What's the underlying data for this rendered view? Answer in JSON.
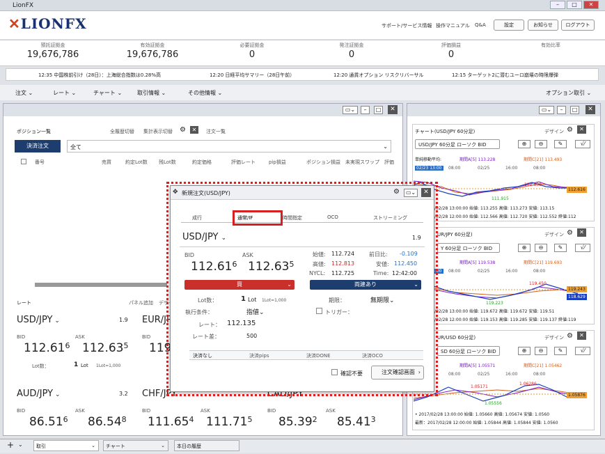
{
  "app": {
    "title": "LionFX",
    "logo": "LIONFX"
  },
  "header": {
    "links": [
      "サポート/サービス情報",
      "操作マニュアル",
      "Q&A"
    ],
    "buttons": [
      "設定",
      "お知らせ",
      "ログアウト"
    ]
  },
  "summary": [
    {
      "label": "預託証拠金",
      "value": "19,676,786"
    },
    {
      "label": "有効証拠金",
      "value": "19,676,786"
    },
    {
      "label": "必要証拠金",
      "value": "0"
    },
    {
      "label": "発注証拠金",
      "value": "0"
    },
    {
      "label": "評価損益",
      "value": "0"
    },
    {
      "label": "有効比率",
      "value": ""
    }
  ],
  "ticker": [
    "12:35 中国株前引け（28日）：上海総合指数は0.28%高",
    "12:20 日経平均サマリー（28日午前）",
    "12:20 通貨オプション リスクリバーサル",
    "12:15 ターゲット2に潜むユーロ崩壊の時限爆弾"
  ],
  "menu": [
    "注文",
    "レート",
    "チャート",
    "取引情報",
    "その他情報"
  ],
  "menu_right": "オプション取引",
  "positions": {
    "title": "ポジション一覧",
    "links": [
      "全履歴切替",
      "集計表示切替"
    ],
    "tab2": "注文一覧",
    "settle_btn": "決済注文",
    "filter": "全て",
    "columns": [
      "番号",
      "売買",
      "約定Lot数",
      "残Lot数",
      "約定価格",
      "評価レート",
      "pip損益",
      "ポジション損益",
      "未実現スワップ",
      "評価"
    ]
  },
  "rate_panel": {
    "title": "レート",
    "link1": "パネル追加",
    "link2": "デザイン",
    "pairs": [
      {
        "sym": "USD/JPY",
        "spread": "1.9",
        "bid_label": "BID",
        "ask_label": "ASK",
        "bid_a": "112.61",
        "bid_b": "6",
        "ask_a": "112.63",
        "ask_b": "5",
        "lot_label": "Lot数：",
        "lot": "1",
        "lot_unit": "Lot",
        "lot_note": "1Lot=1,000"
      },
      {
        "sym": "EUR/JPY",
        "spread": "",
        "bid_label": "BID",
        "ask_label": "",
        "bid_a": "119",
        "bid_b": "",
        "ask_a": "",
        "ask_b": ""
      },
      {
        "sym": "AUD/JPY",
        "spread": "3.2",
        "bid_label": "BID",
        "ask_label": "ASK",
        "bid_a": "86.51",
        "bid_b": "6",
        "ask_a": "86.54",
        "ask_b": "8"
      },
      {
        "sym": "CHF/JPY",
        "spread": "",
        "bid_label": "BID",
        "ask_label": "ASK",
        "bid_a": "111.65",
        "bid_b": "4",
        "ask_a": "111.71",
        "ask_b": "5"
      },
      {
        "sym": "CAD/JPY",
        "spread": "",
        "bid_label": "BID",
        "ask_label": "ASK",
        "bid_a": "85.39",
        "bid_b": "2",
        "ask_a": "85.41",
        "ask_b": "3"
      }
    ]
  },
  "dialog": {
    "title": "新規注文(USD/JPY)",
    "tabs": [
      "成行",
      "通常/IF",
      "時間指定",
      "OCO",
      "ストリーミング"
    ],
    "pair": "USD/JPY",
    "spread": "1.9",
    "bid_label": "BID",
    "ask_label": "ASK",
    "bid_a": "112.61",
    "bid_b": "6",
    "ask_a": "112.63",
    "ask_b": "5",
    "stats": {
      "open_l": "始値:",
      "open": "112.724",
      "prev_l": "前日比:",
      "prev": "-0.109",
      "high_l": "高値:",
      "high": "112.813",
      "low_l": "安値:",
      "low": "112.450",
      "nycl_l": "NYCL:",
      "nycl": "112.725",
      "time_l": "Time:",
      "time": "12:42:00"
    },
    "buy": "買",
    "sell": "両建あり",
    "lot_l": "Lot数：",
    "lot": "1",
    "lot_unit": "Lot",
    "lot_note": "1Lot=1,000",
    "expiry_l": "期限：",
    "expiry": "無期限",
    "cond_l": "執行条件：",
    "cond": "指値",
    "trigger": "トリガー：",
    "rate_l": "レート：",
    "rate": "112.135",
    "diff_l": "レート差：",
    "diff": "500",
    "settle_tabs": [
      "決済なし",
      "決済pips",
      "決済DONE",
      "決済OCO"
    ],
    "confirm_cb": "確認不要",
    "confirm_btn": "注文確認画面"
  },
  "charts": [
    {
      "title": "チャート(USD/JPY 60分足)",
      "design": "デザイン",
      "btn": "USD/JPY 60分足 ローソク BID",
      "ma": "単純移動平均:",
      "ma1": "期間A[5] 113.228",
      "ma2": "期間C[21] 113.493",
      "date": "02/23 13:00",
      "times": [
        "08:00",
        "02/25",
        "16:00",
        "08:00"
      ],
      "hi": "112.830",
      "lo": "111.915",
      "last": "112.616",
      "f1": "/02/28 13:00:00 始値: 113.255 高値: 113.273 安値: 113.15",
      "f2": "/02/28 12:00:00 始値: 112.566 高値: 112.720 安値: 112.552 終値:112"
    },
    {
      "title": "UR/JPY 60分足)",
      "design": "デザイン",
      "btn": "Y 60分足 ローソク BID",
      "ma": "",
      "ma1": "期間A[5] 119.538",
      "ma2": "期間C[21] 119.693",
      "date": "02/23 13:00",
      "times": [
        "08:00",
        "02/25",
        "16:00",
        "08:00"
      ],
      "hi": "119.450",
      "lo": "119.223",
      "last": "119.243",
      "last2": "118.629",
      "f1": "/02/28 13:00:00 始値: 119.672 高値: 119.672 安値: 119.51",
      "f2": "/02/28 12:00:00 始値: 119.153 高値: 119.285 安値: 119.137 終値:119"
    },
    {
      "title": "UR/USD 60分足)",
      "design": "デザイン",
      "btn": "SD 60分足 ローソク BID",
      "ma": "",
      "ma1": "期間A[5] 1.05571",
      "ma2": "期間C[21] 1.05462",
      "date": "",
      "times": [
        "08:00",
        "02/25",
        "16:00",
        "08:00"
      ],
      "hi": "1.06286",
      "hi2": "1.05171",
      "lo": "1.05556",
      "last": "1.05876",
      "f1": "• 2017/02/28 13:00:00 始値: 1.05660 高値: 1.05674 安値: 1.0560",
      "f2": "最新：2017/02/28 12:00:00 始値: 1.05844 高値: 1.05844 安値: 1.0560"
    }
  ],
  "bottom": {
    "items": [
      "取引",
      "チャート",
      "本日の履歴"
    ]
  }
}
